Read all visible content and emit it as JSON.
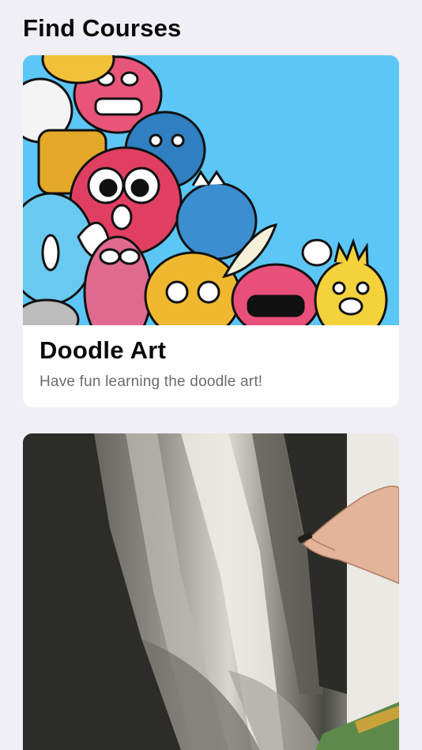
{
  "header": {
    "title": "Find Courses"
  },
  "courses": [
    {
      "title": "Doodle Art",
      "description": "Have fun learning the doodle art!",
      "image": "doodle-monsters-illustration",
      "accent_color": "#5cc6f6"
    },
    {
      "title": "",
      "description": "",
      "image": "charcoal-drawing-photo",
      "accent_color": "#2f2f2a"
    }
  ],
  "colors": {
    "background": "#f0eff5",
    "card": "#ffffff",
    "title_text": "#0a0a0a",
    "subtitle_text": "#6b6b6b"
  }
}
